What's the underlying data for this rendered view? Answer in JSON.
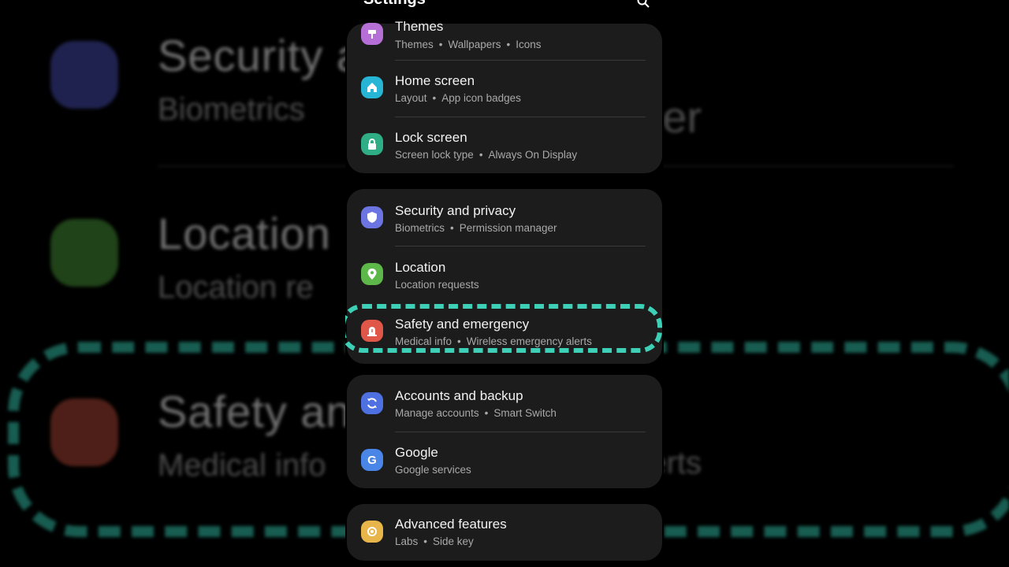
{
  "app": {
    "title": "Settings"
  },
  "background": {
    "security_title": "Security a",
    "security_sub": "Biometrics",
    "security_sub_right": "ger",
    "location_title": "Location",
    "location_sub": "Location re",
    "safety_title": "Safety an",
    "safety_sub": "Medical info",
    "safety_sub_right": "ncy alerts"
  },
  "items": {
    "themes": {
      "title": "Themes",
      "sub": [
        "Themes",
        "Wallpapers",
        "Icons"
      ],
      "color": "#b56fd6"
    },
    "home": {
      "title": "Home screen",
      "sub": [
        "Layout",
        "App icon badges"
      ],
      "color": "#27b5d6"
    },
    "lock": {
      "title": "Lock screen",
      "sub": [
        "Screen lock type",
        "Always On Display"
      ],
      "color": "#2fae86"
    },
    "security": {
      "title": "Security and privacy",
      "sub": [
        "Biometrics",
        "Permission manager"
      ],
      "color": "#6b74e0"
    },
    "location": {
      "title": "Location",
      "sub": [
        "Location requests"
      ],
      "color": "#5eb849"
    },
    "safety": {
      "title": "Safety and emergency",
      "sub": [
        "Medical info",
        "Wireless emergency alerts"
      ],
      "color": "#e0574a"
    },
    "accounts": {
      "title": "Accounts and backup",
      "sub": [
        "Manage accounts",
        "Smart Switch"
      ],
      "color": "#4f70e0"
    },
    "google": {
      "title": "Google",
      "sub": [
        "Google services"
      ],
      "color": "#4a86e8"
    },
    "advanced": {
      "title": "Advanced features",
      "sub": [
        "Labs",
        "Side key"
      ],
      "color": "#e8b54a"
    }
  },
  "accent": "#3ed0b6"
}
